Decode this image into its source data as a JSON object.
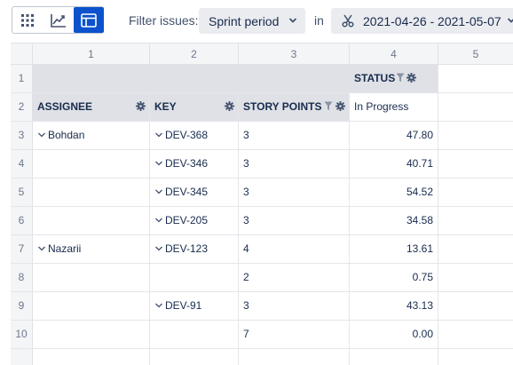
{
  "toolbar": {
    "filter_label": "Filter issues:",
    "period_value": "Sprint period",
    "in_label": "in",
    "range_value": "2021-04-26 - 2021-05-07"
  },
  "grid": {
    "column_numbers": [
      "1",
      "2",
      "3",
      "4",
      "5"
    ],
    "status_header": "STATUS",
    "headers": {
      "assignee": "ASSIGNEE",
      "key": "KEY",
      "story_points": "STORY POINTS",
      "status_value": "In Progress"
    },
    "row_numbers": [
      "1",
      "2",
      "3",
      "4",
      "5",
      "6",
      "7",
      "8",
      "9",
      "10"
    ],
    "rows": [
      {
        "assignee": "Bohdan",
        "key": "DEV-368",
        "points": "3",
        "value": "47.80"
      },
      {
        "assignee": "",
        "key": "DEV-346",
        "points": "3",
        "value": "40.71"
      },
      {
        "assignee": "",
        "key": "DEV-345",
        "points": "3",
        "value": "54.52"
      },
      {
        "assignee": "",
        "key": "DEV-205",
        "points": "3",
        "value": "34.58"
      },
      {
        "assignee": "Nazarii",
        "key": "DEV-123",
        "points": "4",
        "value": "13.61"
      },
      {
        "assignee": "",
        "key": "",
        "points": "2",
        "value": "0.75"
      },
      {
        "assignee": "",
        "key": "DEV-91",
        "points": "3",
        "value": "43.13"
      },
      {
        "assignee": "",
        "key": "",
        "points": "7",
        "value": "0.00"
      }
    ]
  },
  "icons": {
    "view_grid": "grid-icon",
    "view_chart": "chart-icon",
    "view_table": "table-view-icon",
    "gear": "gear-icon",
    "filter": "funnel-icon",
    "expand": "chevron-down-icon",
    "scissors": "scissors-icon"
  },
  "colors": {
    "accent": "#0b52cc",
    "header_shade": "#dfe1e6",
    "text": "#172b4d"
  }
}
